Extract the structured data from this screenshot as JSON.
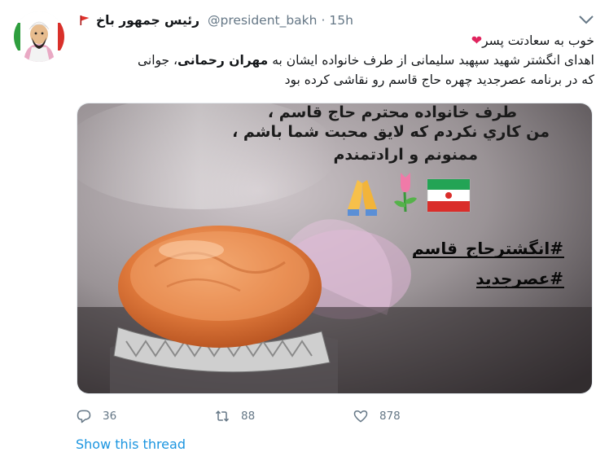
{
  "tweet": {
    "display_name": "رئیس جمهور باخ",
    "handle": "@president_bakh",
    "separator": "·",
    "time": "15h",
    "text_line1": "خوب به سعادتت پسر",
    "text_line2_part1": "اهدای انگشتر شهید سپهبد سلیمانی از طرف خانواده ایشان به ",
    "text_line2_bold": "مهران رحمانی",
    "text_line2_part2": "، جوانی",
    "text_line3": "که در برنامه عصرجدید چهره حاج قاسم رو نقاشی کرده بود",
    "emoji_heart": "❤"
  },
  "media": {
    "line1": "طرف خانواده محترم حاج قاسم ،",
    "line2": "من کاري نکردم که لایق محبت شما باشم ،",
    "line3": "ممنونم و ارادتمندم",
    "hashtag1": "#انگشترحاج_قاسم",
    "hashtag2": "#عصرجدید"
  },
  "actions": {
    "replies": "36",
    "retweets": "88",
    "likes": "878"
  },
  "show_thread": "Show this thread",
  "icons": [
    "avatar",
    "red-flag-icon",
    "chevron-down-icon",
    "reply-icon",
    "retweet-icon",
    "like-icon"
  ],
  "colors": {
    "link": "#1b95e0",
    "muted": "#657786",
    "heart": "#e0245e"
  }
}
